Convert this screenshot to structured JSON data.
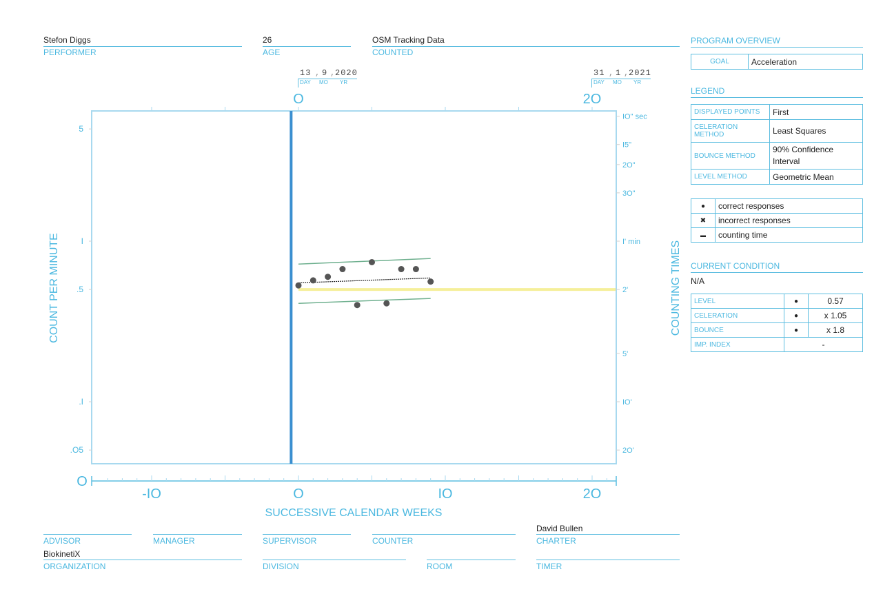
{
  "header": {
    "performer": {
      "value": "Stefon Diggs",
      "label": "PERFORMER"
    },
    "age": {
      "value": "26",
      "label": "AGE"
    },
    "counted": {
      "value": "OSM Tracking Data",
      "label": "COUNTED"
    }
  },
  "dates": {
    "start": {
      "day": "13",
      "mo": "9",
      "yr": "2020"
    },
    "end": {
      "day": "31",
      "mo": "1",
      "yr": "2021"
    },
    "labels": {
      "day": "DAY",
      "mo": "MO",
      "yr": "YR"
    }
  },
  "program_overview": {
    "title": "PROGRAM OVERVIEW",
    "goal_label": "GOAL",
    "goal_value": "Acceleration"
  },
  "legend": {
    "title": "LEGEND",
    "rows": [
      {
        "key": "DISPLAYED POINTS",
        "value": "First"
      },
      {
        "key": "CELERATION METHOD",
        "value": "Least Squares"
      },
      {
        "key": "BOUNCE METHOD",
        "value": "90% Confidence Interval"
      },
      {
        "key": "LEVEL METHOD",
        "value": "Geometric Mean"
      }
    ],
    "symbols": [
      {
        "icon": "●",
        "label": "correct responses"
      },
      {
        "icon": "✖",
        "label": "incorrect responses"
      },
      {
        "icon": "▬",
        "label": "counting time"
      }
    ]
  },
  "current_condition": {
    "title": "CURRENT CONDITION",
    "value": "N/A",
    "rows": [
      {
        "key": "LEVEL",
        "icon": "●",
        "value": "0.57"
      },
      {
        "key": "CELERATION",
        "icon": "●",
        "value": "x 1.05"
      },
      {
        "key": "BOUNCE",
        "icon": "●",
        "value": "x 1.8"
      },
      {
        "key": "IMP. INDEX",
        "icon": "",
        "value": "-"
      }
    ]
  },
  "footer": {
    "advisor": {
      "label": "ADVISOR",
      "value": ""
    },
    "manager": {
      "label": "MANAGER",
      "value": ""
    },
    "supervisor": {
      "label": "SUPERVISOR",
      "value": ""
    },
    "counter": {
      "label": "COUNTER",
      "value": ""
    },
    "charter": {
      "label": "CHARTER",
      "value": "David Bullen"
    },
    "organization": {
      "label": "ORGANIZATION",
      "value": "BiokinetiX"
    },
    "division": {
      "label": "DIVISION",
      "value": ""
    },
    "room": {
      "label": "ROOM",
      "value": ""
    },
    "timer": {
      "label": "TIMER",
      "value": ""
    }
  },
  "chart_data": {
    "type": "scatter",
    "title": "",
    "xlabel": "SUCCESSIVE CALENDAR WEEKS",
    "ylabel": "COUNT PER MINUTE",
    "ylabel_right": "COUNTING TIMES",
    "xlim": [
      -14,
      21.6
    ],
    "ylim": [
      0.041,
      6.5
    ],
    "yscale": "log",
    "x_ticks": [
      {
        "v": -10,
        "label": "-IO"
      },
      {
        "v": 0,
        "label": "O"
      },
      {
        "v": 10,
        "label": "IO"
      },
      {
        "v": 20,
        "label": "2O"
      }
    ],
    "x_origin_label": "O",
    "top_ticks": [
      {
        "v": 0,
        "label": "O"
      },
      {
        "v": 20,
        "label": "2O"
      }
    ],
    "y_ticks": [
      {
        "v": 5,
        "label": "5"
      },
      {
        "v": 1,
        "label": "I"
      },
      {
        "v": 0.5,
        "label": ".5"
      },
      {
        "v": 0.1,
        "label": ".I"
      },
      {
        "v": 0.05,
        "label": ".O5"
      }
    ],
    "right_ticks": [
      {
        "v": 6,
        "label": "IO\" sec"
      },
      {
        "v": 4,
        "label": "I5\""
      },
      {
        "v": 3,
        "label": "2O\""
      },
      {
        "v": 2,
        "label": "3O\""
      },
      {
        "v": 1,
        "label": "I' min"
      },
      {
        "v": 0.5,
        "label": "2'"
      },
      {
        "v": 0.2,
        "label": "5'"
      },
      {
        "v": 0.1,
        "label": "IO'"
      },
      {
        "v": 0.05,
        "label": "2O'"
      }
    ],
    "phase_line_week": -0.5,
    "series": [
      {
        "name": "correct responses",
        "x": [
          0,
          1,
          2,
          3,
          4,
          5,
          6,
          7,
          8,
          9
        ],
        "y": [
          0.53,
          0.57,
          0.6,
          0.67,
          0.4,
          0.74,
          0.41,
          0.67,
          0.67,
          0.56
        ]
      }
    ],
    "celeration_line": {
      "x": [
        0,
        9
      ],
      "y": [
        0.55,
        0.59
      ]
    },
    "bounce_upper": {
      "x": [
        0,
        9
      ],
      "y": [
        0.72,
        0.78
      ]
    },
    "bounce_lower": {
      "x": [
        0,
        9
      ],
      "y": [
        0.41,
        0.44
      ]
    },
    "counting_time_line": {
      "x": [
        0,
        21.6
      ],
      "y": [
        0.5,
        0.5
      ]
    },
    "colors": {
      "axis": "#5bbde0",
      "phase": "#3a8fd0",
      "point": "#555555",
      "bounce": "#6fb08f",
      "celeration": "#222222",
      "timing": "#f5ef9a"
    }
  }
}
